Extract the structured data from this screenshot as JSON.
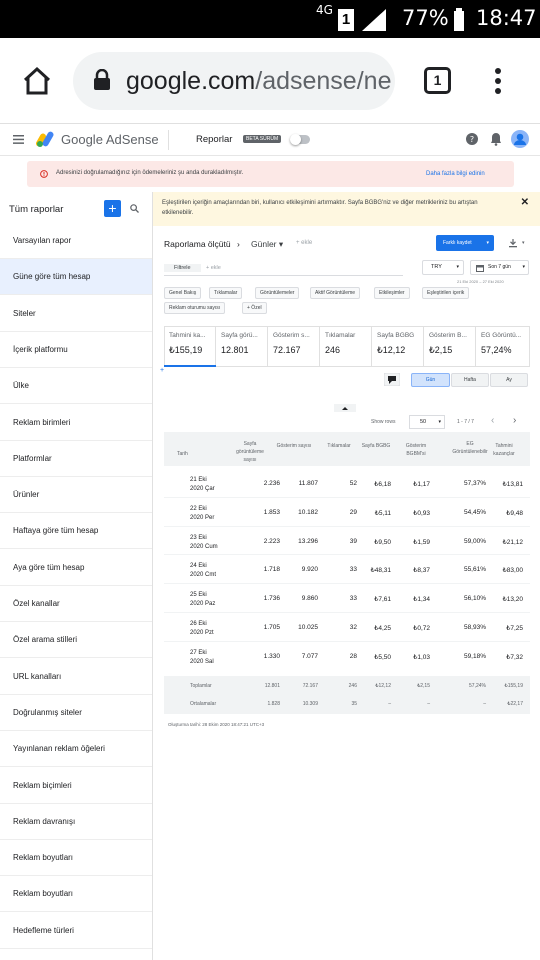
{
  "status_bar": {
    "network": "4G",
    "sim": "1",
    "battery": "77%",
    "time": "18:47"
  },
  "browser": {
    "url_main": "google.com",
    "url_rest": "/adsense/ne",
    "tab_count": "1"
  },
  "app": {
    "title": "Google AdSense",
    "section": "Reporlar",
    "beta": "BETA SÜRÜM"
  },
  "alert": {
    "text": "Adresinizi doğrulamadığınız için ödemeleriniz şu anda durakladılmıştır.",
    "link": "Daha fazla bilgi edinin"
  },
  "sidebar": {
    "title": "Tüm raporlar",
    "items": [
      "Varsayılan rapor",
      "Güne göre tüm hesap",
      "Siteler",
      "İçerik platformu",
      "Ülke",
      "Reklam birimleri",
      "Platformlar",
      "Ürünler",
      "Haftaya göre tüm hesap",
      "Aya göre tüm hesap",
      "Özel kanallar",
      "Özel arama stilleri",
      "URL kanalları",
      "Doğrulanmış siteler",
      "Yayınlanan reklam öğeleri",
      "Reklam biçimleri",
      "Reklam davranışı",
      "Reklam boyutları",
      "Reklam boyutları",
      "Hedefleme türleri"
    ]
  },
  "notice": {
    "text": "Eşleştirilen içeriğin amaçlarından biri, kullanıcı etkileşimini artırmaktır. Sayfa BGBG'niz ve diğer metrikleriniz bu artıştan etkilenebilir."
  },
  "report": {
    "breadcrumb_1": "Raporlama ölçütü",
    "breadcrumb_sep": "›",
    "breadcrumb_2": "Günler",
    "add": "+ ekle",
    "save": "Farklı kaydet",
    "filter": "Filtrele",
    "filter_add": "+ ekle",
    "currency": "TRY",
    "range": "Son 7 gün",
    "date_range": "21 Eki 2020 – 27 Eki 2020",
    "tabs_row1": [
      "Genel Bakış",
      "Tıklamalar",
      "Görüntülemeler",
      "Aktif Görüntüleme",
      "Etkileşimler",
      "Eşleştirilen içerik"
    ],
    "tabs_row2": [
      "Reklam oturumu sayısı",
      "+ Özel"
    ],
    "metrics": [
      {
        "label": "Tahmini ka...",
        "value": "₺155,19"
      },
      {
        "label": "Sayfa görü...",
        "value": "12.801"
      },
      {
        "label": "Gösterim s...",
        "value": "72.167"
      },
      {
        "label": "Tıklamalar",
        "value": "246"
      },
      {
        "label": "Sayfa BGBG",
        "value": "₺12,12"
      },
      {
        "label": "Gösterim B...",
        "value": "₺2,15"
      },
      {
        "label": "EG Görüntü...",
        "value": "57,24%"
      }
    ],
    "granularity": [
      "Gün",
      "Hafta",
      "Ay"
    ],
    "show_rows_label": "Show rows",
    "show_rows_value": "50",
    "pagination": "1 - 7 / 7",
    "columns": [
      "Tarih",
      "Sayfa görüntüleme sayısı",
      "Gösterim sayısı",
      "Tıklamalar",
      "Sayfa BGBG",
      "Gösterim BGBM'si",
      "EG Görüntülenebilir",
      "Tahmini kazançlar"
    ],
    "rows": [
      {
        "date1": "21 Eki",
        "date2": "2020 Çar",
        "c": [
          "2.236",
          "11.807",
          "52",
          "₺6,18",
          "₺1,17",
          "57,37%",
          "₺13,81"
        ]
      },
      {
        "date1": "22 Eki",
        "date2": "2020 Per",
        "c": [
          "1.853",
          "10.182",
          "29",
          "₺5,11",
          "₺0,93",
          "54,45%",
          "₺9,48"
        ]
      },
      {
        "date1": "23 Eki",
        "date2": "2020 Cum",
        "c": [
          "2.223",
          "13.296",
          "39",
          "₺9,50",
          "₺1,59",
          "59,00%",
          "₺21,12"
        ]
      },
      {
        "date1": "24 Eki",
        "date2": "2020 Cmt",
        "c": [
          "1.718",
          "9.920",
          "33",
          "₺48,31",
          "₺8,37",
          "55,61%",
          "₺83,00"
        ]
      },
      {
        "date1": "25 Eki",
        "date2": "2020 Paz",
        "c": [
          "1.736",
          "9.860",
          "33",
          "₺7,61",
          "₺1,34",
          "56,10%",
          "₺13,20"
        ]
      },
      {
        "date1": "26 Eki",
        "date2": "2020 Pzt",
        "c": [
          "1.705",
          "10.025",
          "32",
          "₺4,25",
          "₺0,72",
          "58,93%",
          "₺7,25"
        ]
      },
      {
        "date1": "27 Eki",
        "date2": "2020 Sal",
        "c": [
          "1.330",
          "7.077",
          "28",
          "₺5,50",
          "₺1,03",
          "59,18%",
          "₺7,32"
        ]
      }
    ],
    "totals": {
      "label": "Toplamlar",
      "c": [
        "12.801",
        "72.167",
        "246",
        "₺12,12",
        "₺2,15",
        "57,24%",
        "₺155,19"
      ]
    },
    "averages": {
      "label": "Ortalamalar",
      "c": [
        "1.828",
        "10.309",
        "35",
        "–",
        "–",
        "–",
        "₺22,17"
      ]
    },
    "generated": "Oluşturma tarihi: 28 Ekim 2020 18:47:21 UTC+3"
  },
  "colors": {
    "accent": "#1a73e8",
    "active_bg": "#e8f0fe",
    "alert_bg": "#fce8e6",
    "notice_bg": "#fef7e0"
  }
}
